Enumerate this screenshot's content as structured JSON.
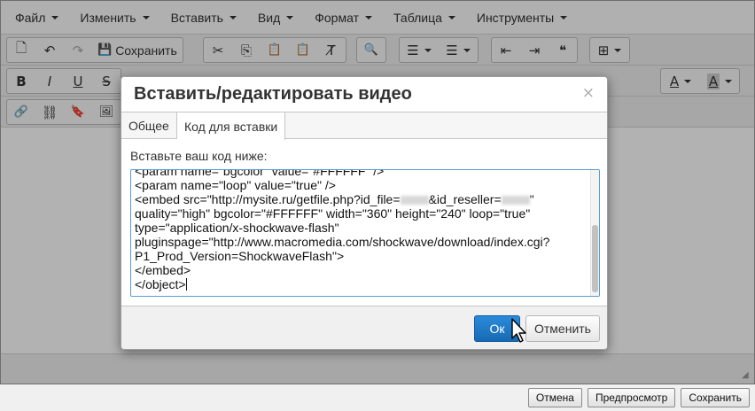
{
  "menubar": {
    "items": [
      "Файл",
      "Изменить",
      "Вставить",
      "Вид",
      "Формат",
      "Таблица",
      "Инструменты"
    ]
  },
  "toolbar": {
    "save_label": "Сохранить",
    "icons": {
      "new_doc": "🗋",
      "undo": "↶",
      "redo": "↷",
      "save": "💾",
      "cut": "✂",
      "copy": "⎘",
      "paste": "📋",
      "paste_text": "📋",
      "clear_format": "T̸",
      "find": "🔍",
      "bullet_list": "☰",
      "numbered_list": "☰",
      "outdent": "⇤",
      "indent": "⇥",
      "blockquote": "❝",
      "table": "⊞",
      "bold": "B",
      "italic": "I",
      "underline": "U",
      "strike": "S",
      "text_color": "A",
      "bg_color": "A",
      "link": "🔗",
      "unlink": "⛓",
      "bookmark": "🔖",
      "image": "🖼"
    }
  },
  "dialog": {
    "title": "Вставить/редактировать видео",
    "close": "×",
    "tabs": [
      {
        "label": "Общее",
        "active": false
      },
      {
        "label": "Код для вставки",
        "active": true
      }
    ],
    "embed_label": "Вставьте ваш код ниже:",
    "code": {
      "line0": "<param name=\"bgcolor\" value=\"#FFFFFF\" />",
      "line1": "<param name=\"loop\" value=\"true\" />",
      "line2a": "<embed src=\"http://mysite.ru/getfile.php?id_file=",
      "line2b": "&id_reseller=",
      "line2c": "\"",
      "line3": "quality=\"high\" bgcolor=\"#FFFFFF\" width=\"360\" height=\"240\" loop=\"true\"",
      "line4": "type=\"application/x-shockwave-flash\"",
      "line5": "pluginspage=\"http://www.macromedia.com/shockwave/download/index.cgi?",
      "line6": "P1_Prod_Version=ShockwaveFlash\">",
      "line7": "</embed>",
      "line8": "</object>"
    },
    "ok_label": "Ок",
    "cancel_label": "Отменить"
  },
  "footer": {
    "cancel": "Отмена",
    "preview": "Предпросмотр",
    "save": "Сохранить"
  },
  "colors": {
    "accent": "#1f7bc9",
    "text": "#333333",
    "toolbar_bg": "#f0f0f0"
  }
}
